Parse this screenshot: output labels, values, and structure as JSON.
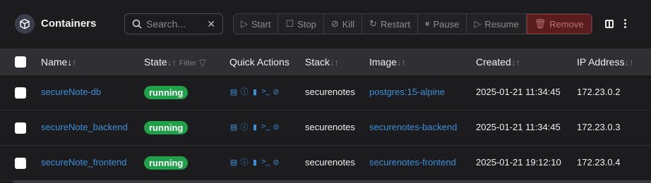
{
  "header": {
    "title": "Containers",
    "title_icon": "cube-icon"
  },
  "search": {
    "placeholder": "Search...",
    "clear": "✕"
  },
  "toolbar": {
    "buttons": [
      {
        "label": "Start",
        "icon": "play-icon",
        "glyph": "▷"
      },
      {
        "label": "Stop",
        "icon": "stop-icon",
        "glyph": "☐"
      },
      {
        "label": "Kill",
        "icon": "ban-icon",
        "glyph": "⊘"
      },
      {
        "label": "Restart",
        "icon": "refresh-icon",
        "glyph": "↻"
      },
      {
        "label": "Pause",
        "icon": "pause-icon",
        "glyph": "⏸"
      },
      {
        "label": "Resume",
        "icon": "resume-icon",
        "glyph": "▷"
      },
      {
        "label": "Remove",
        "icon": "trash-icon",
        "glyph": "🗑"
      }
    ]
  },
  "table": {
    "columns": {
      "name": "Name",
      "state": "State",
      "filter": "Filter",
      "quick_actions": "Quick Actions",
      "stack": "Stack",
      "image": "Image",
      "created": "Created",
      "ip": "IP Address"
    },
    "rows": [
      {
        "name": "secureNote-db",
        "state": "running",
        "stack": "securenotes",
        "image": "postgres:15-alpine",
        "created": "2025-01-21 11:34:45",
        "ip": "172.23.0.2"
      },
      {
        "name": "secureNote_backend",
        "state": "running",
        "stack": "securenotes",
        "image": "securenotes-backend",
        "created": "2025-01-21 11:34:45",
        "ip": "172.23.0.3"
      },
      {
        "name": "secureNote_frontend",
        "state": "running",
        "stack": "securenotes",
        "image": "securenotes-frontend",
        "created": "2025-01-21 19:12:10",
        "ip": "172.23.0.4"
      }
    ]
  },
  "colors": {
    "accent": "#3b8fd9",
    "running": "#21a04a",
    "danger": "#5a1d1d"
  }
}
